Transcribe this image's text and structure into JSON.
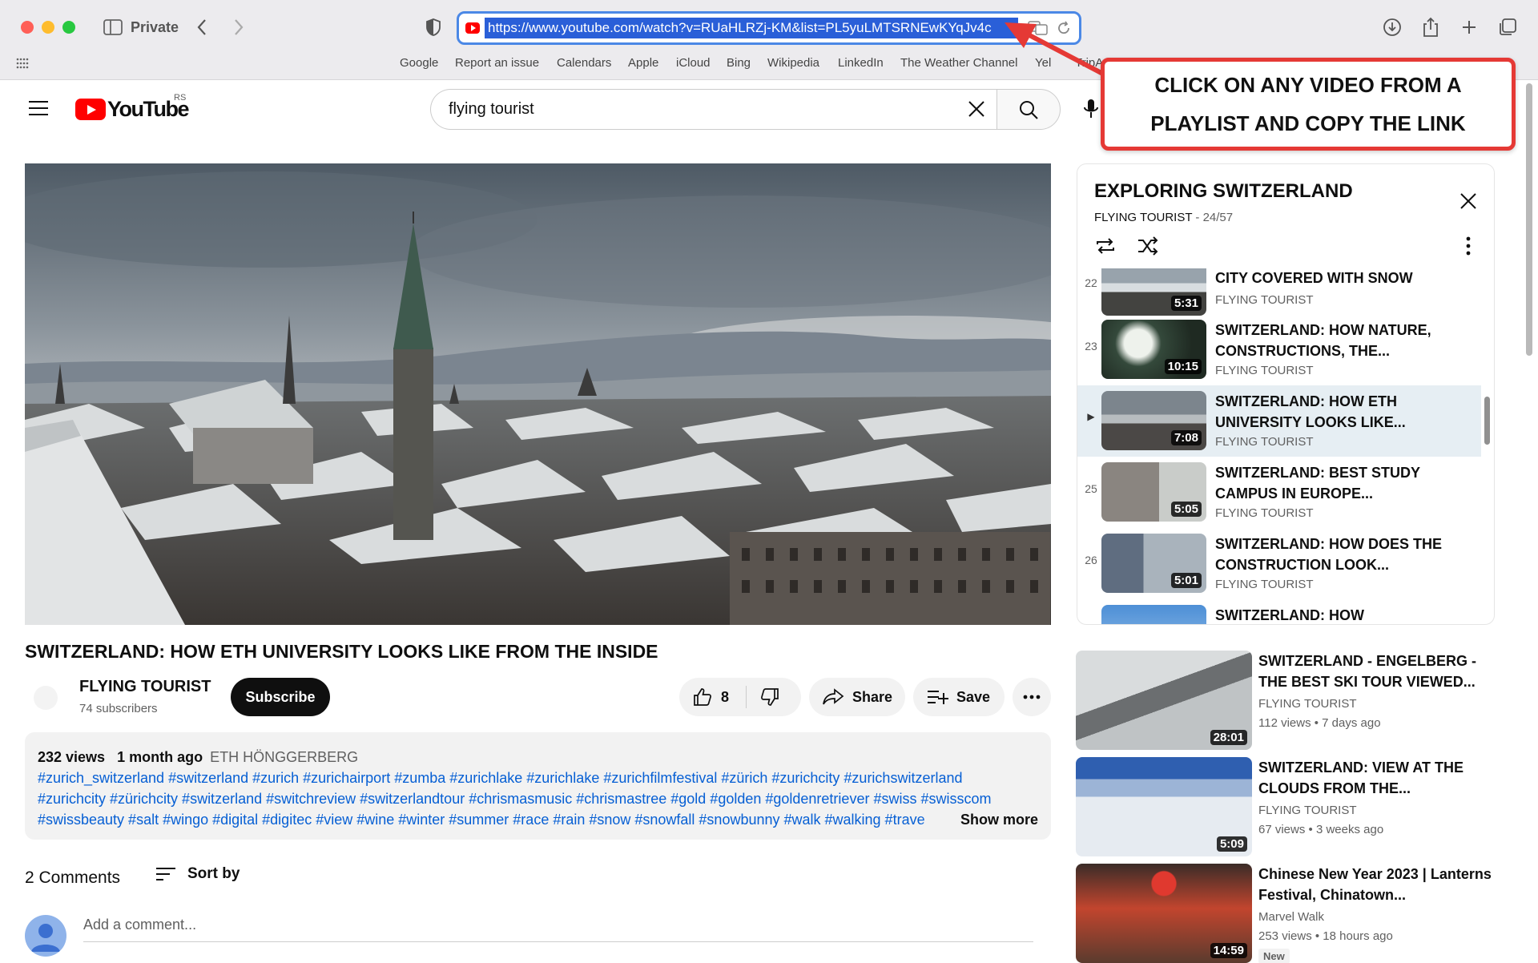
{
  "browser": {
    "private_label": "Private",
    "url": "https://www.youtube.com/watch?v=RUaHLRZj-KM&list=PL5yuLMTSRNEwKYqJv4c",
    "bookmarks": [
      "Google",
      "Report an issue",
      "Calendars",
      "Apple",
      "iCloud",
      "Bing",
      "Wikipedia",
      "LinkedIn",
      "The Weather Channel",
      "Yel",
      "TripA"
    ]
  },
  "annotation": {
    "text": "CLICK ON ANY VIDEO FROM A PLAYLIST AND COPY THE LINK",
    "color": "#e53935"
  },
  "header": {
    "logo": "YouTube",
    "region": "RS",
    "search_value": "flying tourist"
  },
  "video": {
    "title": "SWITZERLAND: HOW ETH UNIVERSITY LOOKS LIKE FROM THE INSIDE",
    "channel": "FLYING TOURIST",
    "subscribers": "74 subscribers",
    "subscribe_label": "Subscribe",
    "likes": "8",
    "share_label": "Share",
    "save_label": "Save"
  },
  "description": {
    "views": "232 views",
    "age": "1 month ago",
    "location": "ETH HÖNGGERBERG",
    "tags_line1": "#zurich_switzerland #switzerland #zurich #zurichairport #zumba #zurichlake #zurichlake #zurichfilmfestival #zürich #zurichcity #zurichswitzerland",
    "tags_line2": "#zurichcity #zürichcity #switzerland #switchreview #switzerlandtour #chrismasmusic #chrismastree #gold #golden #goldenretriever #swiss #swisscom",
    "tags_line3": "#swissbeauty #salt #wingo #digital #digitec #view #wine #winter #summer #race #rain #snow #snowfall #snowbunny #walk #walking #trave",
    "show_more": "Show more"
  },
  "comments": {
    "count_label": "2 Comments",
    "sort_label": "Sort by",
    "input_placeholder": "Add a comment..."
  },
  "playlist": {
    "title": "EXPLORING SWITZERLAND",
    "channel": "FLYING TOURIST",
    "position": "- 24/57",
    "items": [
      {
        "index": "22",
        "title": "CITY COVERED WITH SNOW",
        "channel": "FLYING TOURIST",
        "duration": "5:31"
      },
      {
        "index": "23",
        "title": "SWITZERLAND: HOW NATURE, CONSTRUCTIONS, THE...",
        "channel": "FLYING TOURIST",
        "duration": "10:15"
      },
      {
        "index": "▶",
        "title": "SWITZERLAND: HOW ETH UNIVERSITY LOOKS LIKE...",
        "channel": "FLYING TOURIST",
        "duration": "7:08"
      },
      {
        "index": "25",
        "title": "SWITZERLAND: BEST STUDY CAMPUS IN EUROPE...",
        "channel": "FLYING TOURIST",
        "duration": "5:05"
      },
      {
        "index": "26",
        "title": "SWITZERLAND: HOW DOES THE CONSTRUCTION LOOK...",
        "channel": "FLYING TOURIST",
        "duration": "5:01"
      },
      {
        "index": "",
        "title": "SWITZERLAND: HOW",
        "channel": "",
        "duration": ""
      }
    ]
  },
  "recommendations": [
    {
      "title": "SWITZERLAND - ENGELBERG - THE BEST SKI TOUR VIEWED...",
      "channel": "FLYING TOURIST",
      "meta": "112 views  •  7 days ago",
      "duration": "28:01",
      "badge": ""
    },
    {
      "title": "SWITZERLAND: VIEW AT THE CLOUDS FROM THE...",
      "channel": "FLYING TOURIST",
      "meta": "67 views  •  3 weeks ago",
      "duration": "5:09",
      "badge": ""
    },
    {
      "title": "Chinese New Year 2023 | Lanterns Festival, Chinatown...",
      "channel": "Marvel Walk",
      "meta": "253 views  •  18 hours ago",
      "duration": "14:59",
      "badge": "New"
    }
  ]
}
